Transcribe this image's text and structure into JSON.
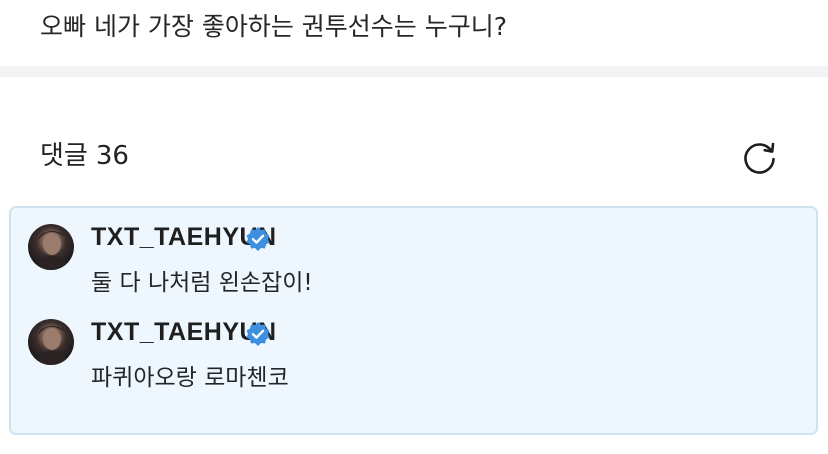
{
  "post": {
    "question": "오빠 네가 가장 좋아하는 권투선수는 누구니?"
  },
  "comments": {
    "label": "댓글",
    "count": "36",
    "refresh_icon": "refresh-icon"
  },
  "replies": [
    {
      "username": "TXT_TAEHYUN",
      "verified_icon": "verified-badge-icon",
      "message": "둘 다 나처럼 왼손잡이!"
    },
    {
      "username": "TXT_TAEHYUN",
      "verified_icon": "verified-badge-icon",
      "message": "파퀴아오랑 로마첸코"
    }
  ],
  "colors": {
    "reply_background": "#eef7fd",
    "reply_border": "#cfe2ef",
    "verified_blue": "#3d8fe0",
    "divider": "#f2f3f5"
  }
}
